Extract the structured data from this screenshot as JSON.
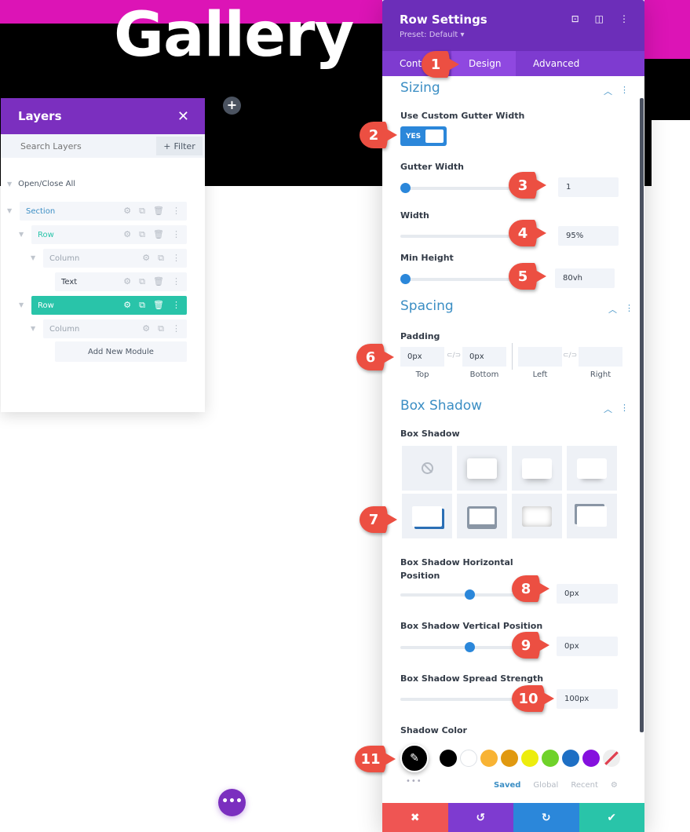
{
  "page": {
    "hero_title": "Gallery",
    "add_section_label": "+",
    "more_label": "•••"
  },
  "layers": {
    "title": "Layers",
    "close_label": "✕",
    "search_placeholder": "Search Layers",
    "filter_label": "Filter",
    "filter_icon": "+",
    "open_close_label": "Open/Close All",
    "items": [
      {
        "label": "Section",
        "color": "#3b8ec4",
        "icons": [
          "⚙",
          "⧉",
          "🗑",
          "⋮"
        ]
      },
      {
        "label": "Row",
        "color": "#29c4a9",
        "icons": [
          "⚙",
          "⧉",
          "🗑",
          "⋮"
        ]
      },
      {
        "label": "Column",
        "color": "#9aa3ae",
        "icons": [
          "⚙",
          "⧉",
          "⋮"
        ]
      },
      {
        "label": "Text",
        "color": "#333b47",
        "icons": [
          "⚙",
          "⧉",
          "🗑",
          "⋮"
        ]
      },
      {
        "label": "Row",
        "color": "#ffffff",
        "icons": [
          "⚙",
          "⧉",
          "🗑",
          "⋮"
        ],
        "active": true
      },
      {
        "label": "Column",
        "color": "#9aa3ae",
        "icons": [
          "⚙",
          "⧉",
          "⋮"
        ]
      },
      {
        "label": "Add New Module",
        "color": "#4d5866"
      }
    ]
  },
  "panel": {
    "title": "Row Settings",
    "preset": "Preset: Default ▾",
    "header_icons": [
      "focus-icon",
      "split-view-icon",
      "more-vertical-icon"
    ],
    "tabs": [
      {
        "label": "Content",
        "shown": "Cont"
      },
      {
        "label": "Design",
        "active": true
      },
      {
        "label": "Advanced"
      }
    ],
    "sizing": {
      "title": "Sizing",
      "custom_gutter_label": "Use Custom Gutter Width",
      "custom_gutter_value": "YES",
      "gutter_width_label": "Gutter Width",
      "gutter_width_value": "1",
      "width_label": "Width",
      "width_value": "95%",
      "min_height_label": "Min Height",
      "min_height_value": "80vh"
    },
    "spacing": {
      "title": "Spacing",
      "padding_label": "Padding",
      "top_value": "0px",
      "bottom_value": "0px",
      "left_value": "",
      "right_value": "",
      "top_label": "Top",
      "bottom_label": "Bottom",
      "left_label": "Left",
      "right_label": "Right"
    },
    "box_shadow": {
      "title": "Box Shadow",
      "style_label": "Box Shadow",
      "selected_style": 5,
      "horizontal_label": "Box Shadow Horizontal Position",
      "horizontal_value": "0px",
      "horizontal_slider": 0.5,
      "vertical_label": "Box Shadow Vertical Position",
      "vertical_value": "0px",
      "vertical_slider": 0.5,
      "spread_label": "Box Shadow Spread Strength",
      "spread_value": "100px",
      "color_label": "Shadow Color",
      "selected_color": "#000000",
      "swatches": [
        "#000000",
        "#ffffff",
        "#f8b334",
        "#e09910",
        "#eded0e",
        "#6fd22a",
        "#1e6fc4",
        "#8510de",
        "transparent"
      ],
      "palette_tabs": [
        "Saved",
        "Global",
        "Recent"
      ],
      "more_label": "•••"
    },
    "footer": {
      "cancel": "✖",
      "undo": "↺",
      "redo": "↻",
      "save": "✔",
      "colors": [
        "#ef5553",
        "#7e3bd0",
        "#2b87da",
        "#29c4a9"
      ]
    }
  },
  "callouts": [
    "1",
    "2",
    "3",
    "4",
    "5",
    "6",
    "7",
    "8",
    "9",
    "10",
    "11"
  ],
  "colors": {
    "accent_purple": "#7b2fbf",
    "accent_blue": "#2b87da",
    "accent_teal": "#29c4a9",
    "callout_red": "#ec4f42",
    "magenta": "#dc14b6"
  }
}
